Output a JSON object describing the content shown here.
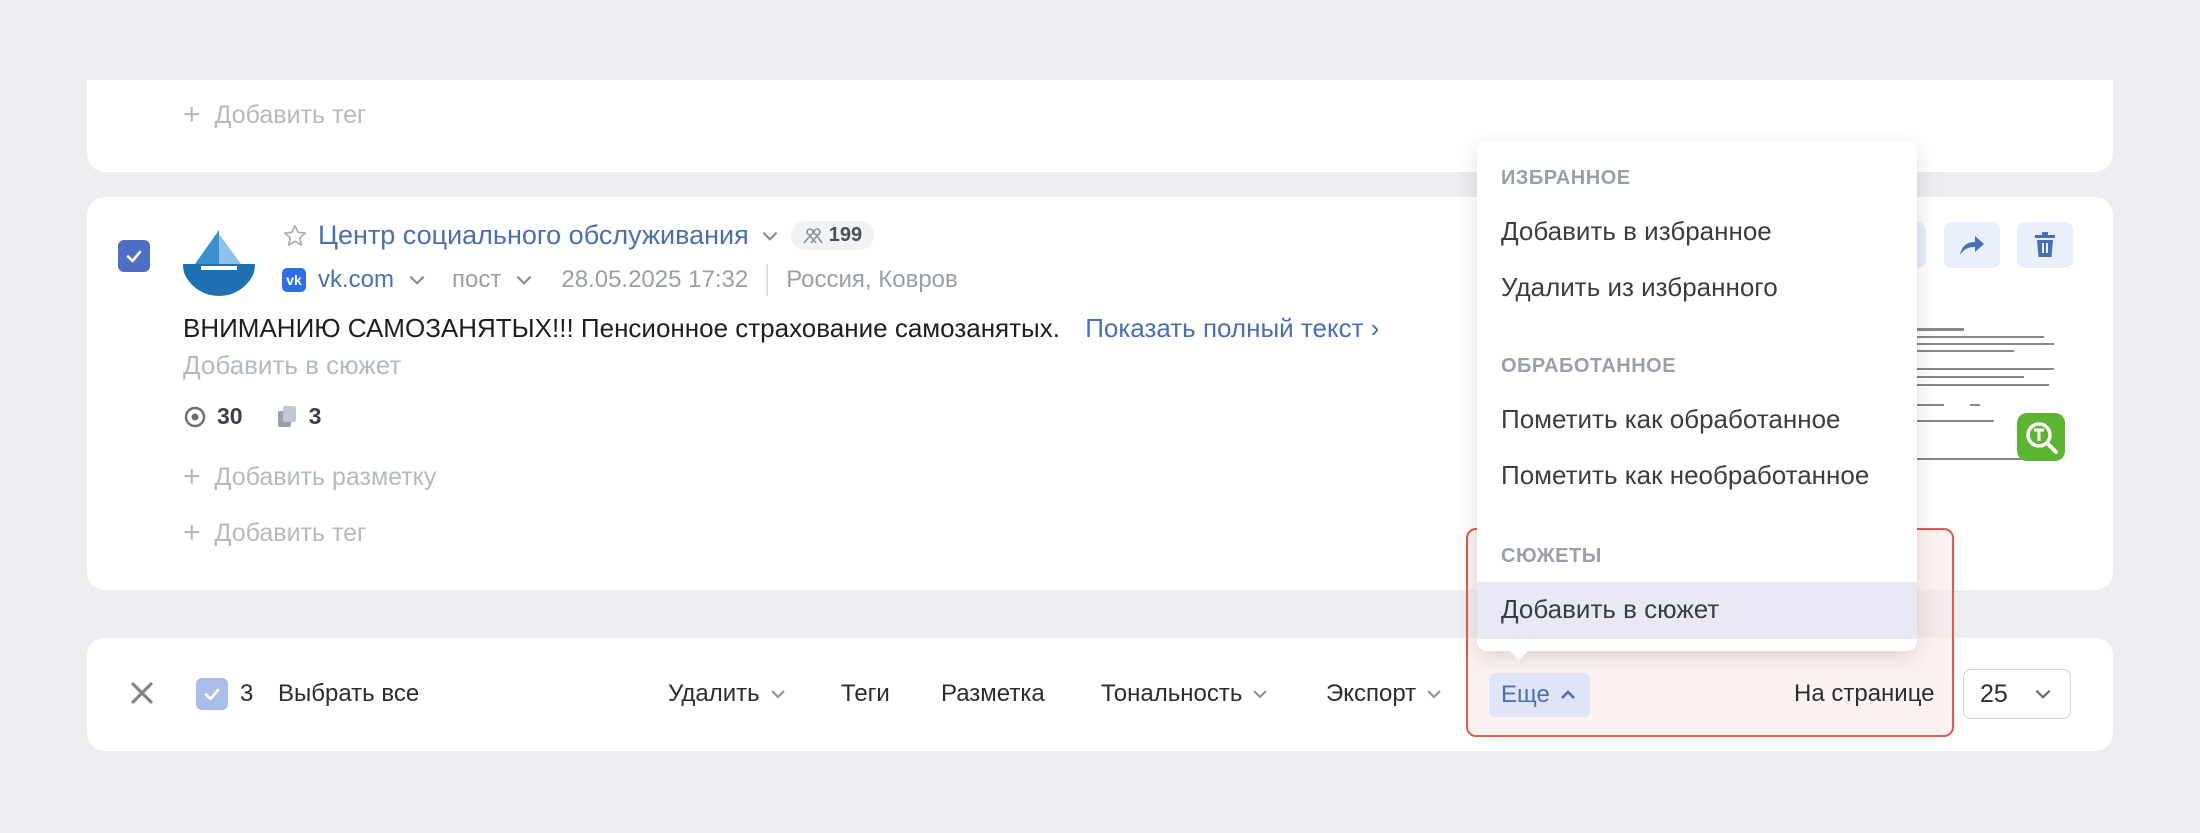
{
  "top_card": {
    "add_tag": "Добавить тег"
  },
  "post": {
    "source_name": "Центр социального обслуживания",
    "audience_count": "199",
    "site": "vk.com",
    "type": "пост",
    "datetime": "28.05.2025 17:32",
    "location": "Россия, Ковров",
    "text": "ВНИМАНИЮ САМОЗАНЯТЫХ!!! Пенсионное страхование самозанятых.",
    "show_full": "Показать полный текст",
    "add_plot": "Добавить в сюжет",
    "views": "30",
    "copies": "3",
    "add_markup": "Добавить разметку",
    "add_tag": "Добавить тег",
    "vk_logo_text": "vk"
  },
  "bulk": {
    "count": "3",
    "select_all": "Выбрать все",
    "delete": "Удалить",
    "tags": "Теги",
    "markup": "Разметка",
    "tonality": "Тональность",
    "export": "Экспорт",
    "more": "Еще",
    "per_page_label": "На странице",
    "per_page_value": "25"
  },
  "menu": {
    "favorites_header": "ИЗБРАННОЕ",
    "add_favorite": "Добавить в избранное",
    "remove_favorite": "Удалить из избранного",
    "processed_header": "ОБРАБОТАННОЕ",
    "mark_processed": "Пометить как обработанное",
    "mark_unprocessed": "Пометить как необработанное",
    "plots_header": "СЮЖЕТЫ",
    "add_to_plot": "Добавить в сюжет"
  },
  "colors": {
    "accent": "#4a6fb7",
    "highlight_border": "#e35a4f",
    "checkbox": "#4f6fc4"
  }
}
